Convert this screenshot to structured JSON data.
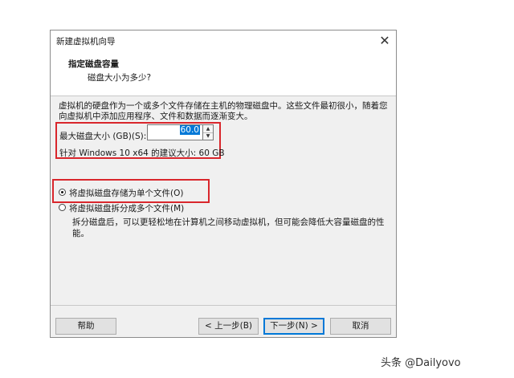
{
  "window": {
    "title": "新建虚拟机向导",
    "close_glyph": "✕"
  },
  "header": {
    "title": "指定磁盘容量",
    "subtitle": "磁盘大小为多少?"
  },
  "description": "虚拟机的硬盘作为一个或多个文件存储在主机的物理磁盘中。这些文件最初很小，随着您向虚拟机中添加应用程序、文件和数据而逐渐变大。",
  "disk_size": {
    "label": "最大磁盘大小 (GB)(S):",
    "value": "60.0",
    "recommendation": "针对 Windows 10 x64 的建议大小: 60 GB",
    "spin_up": "▲",
    "spin_down": "▼"
  },
  "storage_options": [
    {
      "label": "将虚拟磁盘存储为单个文件(O)",
      "checked": true
    },
    {
      "label": "将虚拟磁盘拆分成多个文件(M)",
      "checked": false
    }
  ],
  "split_description": "拆分磁盘后，可以更轻松地在计算机之间移动虚拟机，但可能会降低大容量磁盘的性能。",
  "buttons": {
    "help": "帮助",
    "back": "< 上一步(B)",
    "next": "下一步(N) >",
    "cancel": "取消"
  },
  "watermark": "头条 @Dailyovo",
  "colors": {
    "highlight_border": "#d9262c",
    "selection": "#0078d7"
  }
}
